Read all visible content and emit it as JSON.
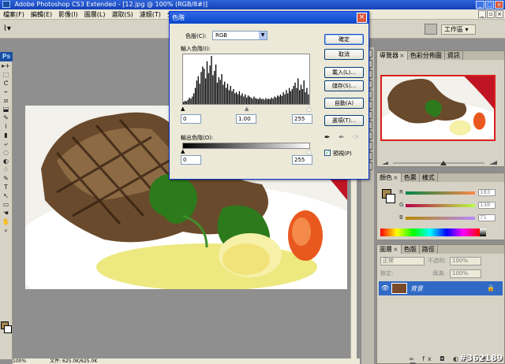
{
  "app": {
    "title": "Adobe Photoshop CS3 Extended - [12.jpg @ 100% (RGB/8#)]"
  },
  "menu": [
    "檔案(F)",
    "編輯(E)",
    "影像(I)",
    "圖層(L)",
    "選取(S)",
    "濾鏡(T)",
    "分析"
  ],
  "optionsbar": {
    "workspace_label": "工作區 ▾"
  },
  "toolbox": {
    "logo": "Ps",
    "tools": [
      "▸+",
      "⬚",
      "ᕦ",
      "⌁",
      "⧄",
      "⬓",
      "✎",
      "⌇",
      "▮",
      "⤶",
      "◌",
      "◐",
      "♢",
      "✎",
      "T",
      "↖",
      "▭",
      "☚",
      "✋",
      "⌕"
    ]
  },
  "colors": {
    "accent": "#316ac5",
    "foreground": "#a48650",
    "dialog_title": "#0a47cc"
  },
  "dialog": {
    "title": "色階",
    "channel_label": "色版(C):",
    "channel_value": "RGB",
    "input_levels_label": "輸入色階(I):",
    "input_black": "0",
    "input_gamma": "1.00",
    "input_white": "255",
    "output_levels_label": "輸出色階(O):",
    "output_black": "0",
    "output_white": "255",
    "buttons": [
      "確定",
      "取消",
      "載入(L)...",
      "儲存(S)...",
      "自動(A)",
      "選項(T)..."
    ],
    "preview_label": "預視(P)",
    "preview_checked": true,
    "histogram": [
      4,
      6,
      5,
      8,
      12,
      10,
      14,
      20,
      30,
      44,
      52,
      38,
      60,
      70,
      66,
      48,
      80,
      58,
      72,
      90,
      54,
      62,
      74,
      40,
      50,
      45,
      56,
      36,
      42,
      30,
      38,
      26,
      34,
      24,
      28,
      20,
      22,
      18,
      24,
      16,
      20,
      14,
      18,
      12,
      16,
      14,
      12,
      10,
      14,
      11,
      10,
      9,
      12,
      9,
      10,
      8,
      11,
      9,
      10,
      9,
      12,
      10,
      14,
      12,
      16,
      14,
      18,
      15,
      22,
      18,
      26,
      20,
      30,
      24,
      28,
      34,
      40,
      30,
      48,
      26,
      36,
      28,
      44,
      22,
      30,
      18
    ]
  },
  "panels": {
    "navigator": {
      "tabs": [
        "導覽器",
        "色彩分佈圖",
        "資訊"
      ]
    },
    "color": {
      "tabs": [
        "顏色",
        "色票",
        "樣式"
      ],
      "r_label": "R",
      "g_label": "G",
      "b_label": "B",
      "r_value": "183",
      "g_value": "138",
      "b_value": "71"
    },
    "layers": {
      "tabs": [
        "圖層",
        "色版",
        "路徑"
      ],
      "blend_mode": "正常",
      "opacity_label": "不透明:",
      "opacity_value": "100%",
      "lock_label": "鎖定:",
      "fill_label": "填滿:",
      "fill_value": "100%",
      "layer_name": "背景",
      "bottom_icons": "∞ fx ◘ ◐ ▭ ⊞ 🗑"
    }
  },
  "status": {
    "zoom": "100%",
    "doc_info": "文件: 625.0K/625.0K"
  },
  "watermark": "#362189",
  "photo_watermark": "#362189"
}
